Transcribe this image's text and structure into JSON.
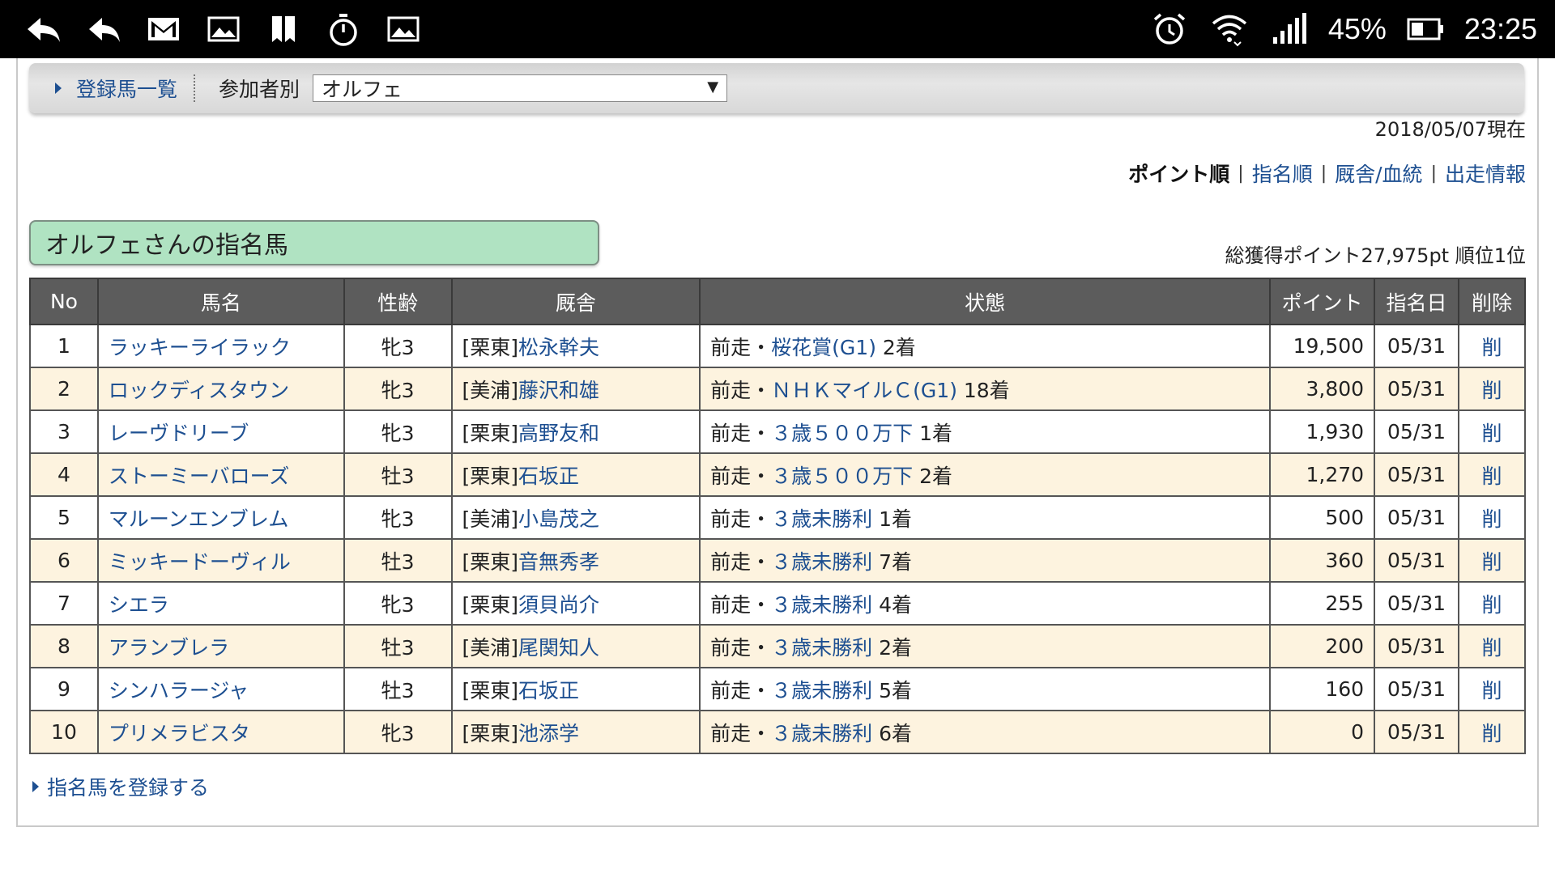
{
  "status_bar": {
    "icons_left": [
      "reply-icon",
      "reply-all-icon",
      "gmail-icon",
      "image-icon",
      "bookmark-icon",
      "stopwatch-icon",
      "image-icon"
    ],
    "battery": "45%",
    "time": "23:25"
  },
  "nav": {
    "link_label": "登録馬一覧",
    "filter_label": "参加者別",
    "select_value": "オルフェ"
  },
  "as_of": "2018/05/07現在",
  "sort": {
    "active": "ポイント順",
    "links": [
      "指名順",
      "厩舎/血統",
      "出走情報"
    ],
    "separator": "|"
  },
  "section_title": "オルフェさんの指名馬",
  "totals": "総獲得ポイント27,975pt 順位1位",
  "table": {
    "headers": [
      "No",
      "馬名",
      "性齢",
      "厩舎",
      "状態",
      "ポイント",
      "指名日",
      "削除"
    ],
    "rows": [
      {
        "no": "1",
        "name": "ラッキーライラック",
        "sex": "牝3",
        "region": "[栗東]",
        "trainer": "松永幹夫",
        "prefix": "前走・",
        "race": "桜花賞(G1)",
        "result": "2着",
        "points": "19,500",
        "date": "05/31",
        "del": "削"
      },
      {
        "no": "2",
        "name": "ロックディスタウン",
        "sex": "牝3",
        "region": "[美浦]",
        "trainer": "藤沢和雄",
        "prefix": "前走・",
        "race": "ＮＨＫマイルＣ(G1)",
        "result": "18着",
        "points": "3,800",
        "date": "05/31",
        "del": "削"
      },
      {
        "no": "3",
        "name": "レーヴドリーブ",
        "sex": "牝3",
        "region": "[栗東]",
        "trainer": "高野友和",
        "prefix": "前走・",
        "race": "３歳５００万下",
        "result": "1着",
        "points": "1,930",
        "date": "05/31",
        "del": "削"
      },
      {
        "no": "4",
        "name": "ストーミーバローズ",
        "sex": "牡3",
        "region": "[栗東]",
        "trainer": "石坂正",
        "prefix": "前走・",
        "race": "３歳５００万下",
        "result": "2着",
        "points": "1,270",
        "date": "05/31",
        "del": "削"
      },
      {
        "no": "5",
        "name": "マルーンエンブレム",
        "sex": "牝3",
        "region": "[美浦]",
        "trainer": "小島茂之",
        "prefix": "前走・",
        "race": "３歳未勝利",
        "result": "1着",
        "points": "500",
        "date": "05/31",
        "del": "削"
      },
      {
        "no": "6",
        "name": "ミッキードーヴィル",
        "sex": "牡3",
        "region": "[栗東]",
        "trainer": "音無秀孝",
        "prefix": "前走・",
        "race": "３歳未勝利",
        "result": "7着",
        "points": "360",
        "date": "05/31",
        "del": "削"
      },
      {
        "no": "7",
        "name": "シエラ",
        "sex": "牝3",
        "region": "[栗東]",
        "trainer": "須貝尚介",
        "prefix": "前走・",
        "race": "３歳未勝利",
        "result": "4着",
        "points": "255",
        "date": "05/31",
        "del": "削"
      },
      {
        "no": "8",
        "name": "アランブレラ",
        "sex": "牡3",
        "region": "[美浦]",
        "trainer": "尾関知人",
        "prefix": "前走・",
        "race": "３歳未勝利",
        "result": "2着",
        "points": "200",
        "date": "05/31",
        "del": "削"
      },
      {
        "no": "9",
        "name": "シンハラージャ",
        "sex": "牡3",
        "region": "[栗東]",
        "trainer": "石坂正",
        "prefix": "前走・",
        "race": "３歳未勝利",
        "result": "5着",
        "points": "160",
        "date": "05/31",
        "del": "削"
      },
      {
        "no": "10",
        "name": "プリメラビスタ",
        "sex": "牝3",
        "region": "[栗東]",
        "trainer": "池添学",
        "prefix": "前走・",
        "race": "３歳未勝利",
        "result": "6着",
        "points": "0",
        "date": "05/31",
        "del": "削"
      }
    ]
  },
  "register_link": "指名馬を登録する",
  "colors": {
    "link": "#1d4f91",
    "header_bg": "#5c5c5c",
    "alt_row": "#fdf3df",
    "title_box": "#b0e3c2"
  }
}
